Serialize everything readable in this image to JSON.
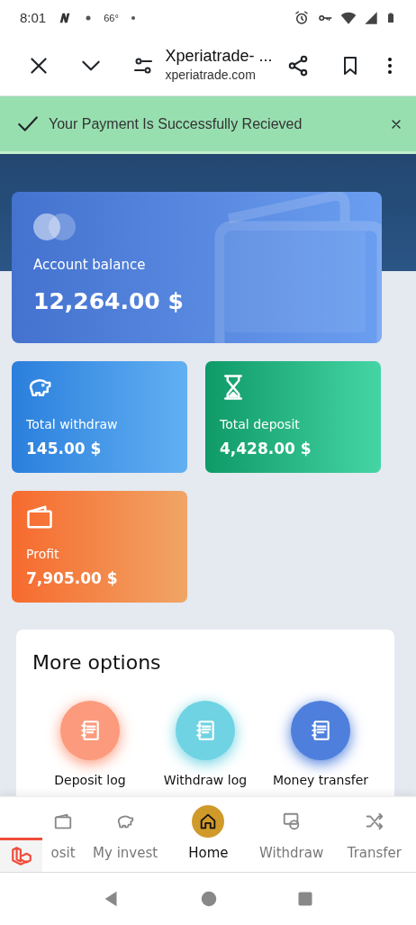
{
  "status_bar": {
    "time": "8:01",
    "temperature": "66°"
  },
  "browser": {
    "title": "Xperiatrade- ...",
    "url": "xperiatrade.com"
  },
  "alert": {
    "message": "Your Payment Is Successfully Recieved"
  },
  "balance": {
    "label": "Account balance",
    "amount": "12,264.00 $"
  },
  "stats": [
    {
      "kind": "withdraw",
      "label": "Total withdraw",
      "amount": "145.00 $"
    },
    {
      "kind": "deposit",
      "label": "Total deposit",
      "amount": "4,428.00 $"
    },
    {
      "kind": "profit",
      "label": "Profit",
      "amount": "7,905.00 $"
    }
  ],
  "more_options": {
    "title": "More options",
    "items": [
      {
        "label": "Deposit log",
        "color": "#fb9a7c"
      },
      {
        "label": "Withdraw log",
        "color": "#6fd3e3"
      },
      {
        "label": "Money transfer",
        "color": "#4e7fdc"
      }
    ]
  },
  "bottom_nav": [
    {
      "kind": "wallet",
      "label": "osit",
      "selected": false
    },
    {
      "kind": "piggy",
      "label": "My invest",
      "selected": false
    },
    {
      "kind": "home",
      "label": "Home",
      "selected": true
    },
    {
      "kind": "cash",
      "label": "Withdraw",
      "selected": false
    },
    {
      "kind": "shuffle",
      "label": "Transfer",
      "selected": false
    }
  ]
}
